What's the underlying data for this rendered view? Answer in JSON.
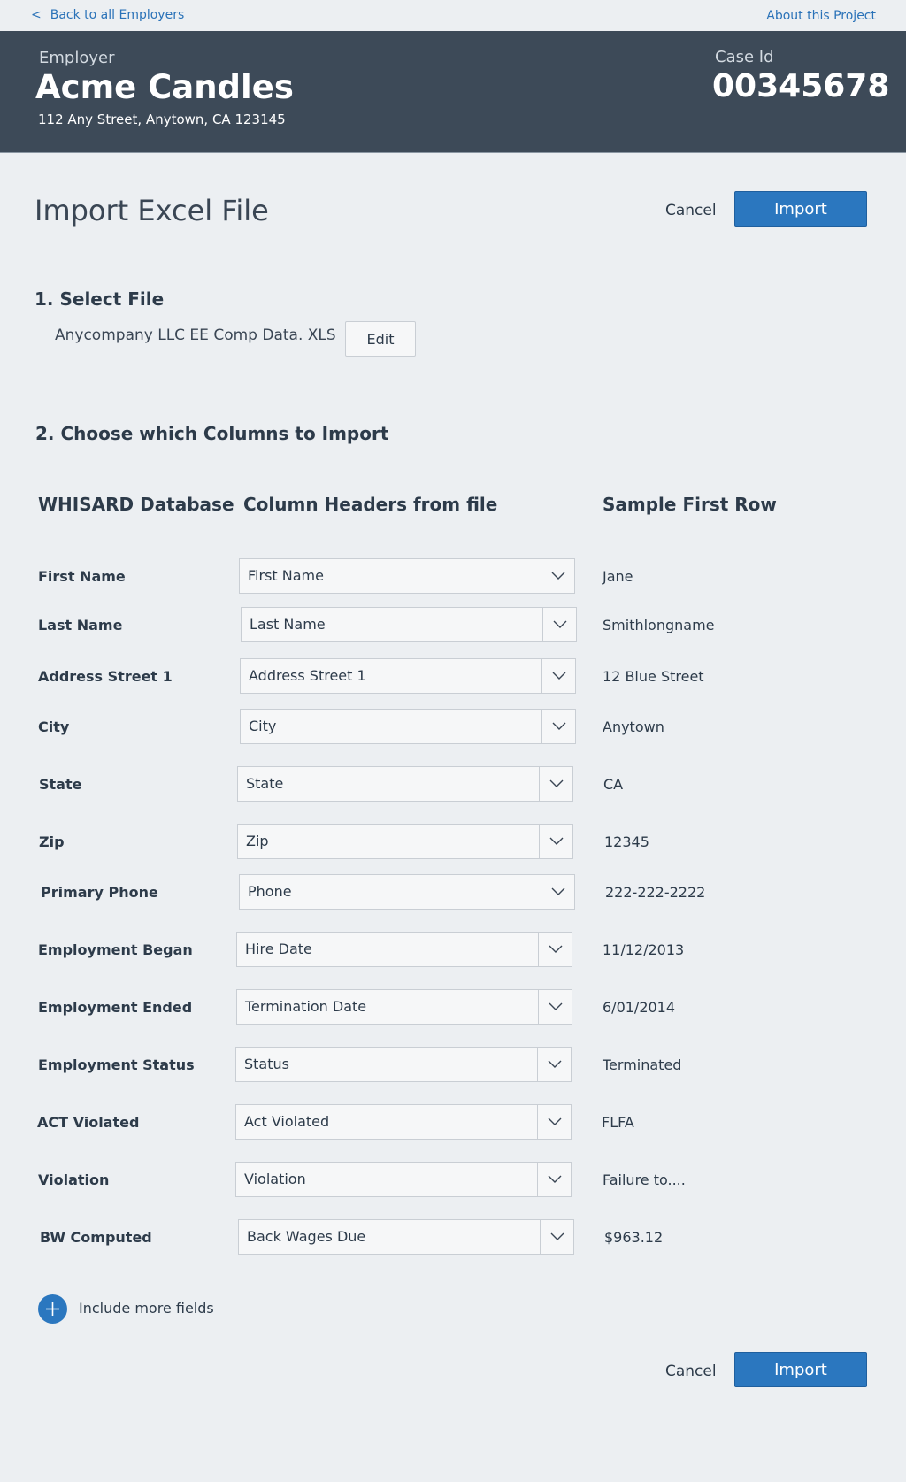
{
  "nav": {
    "back_chevron": "<",
    "back_label": "Back to all Employers",
    "about_label": "About this Project"
  },
  "employer": {
    "label": "Employer",
    "name": "Acme Candles",
    "address": "112 Any Street, Anytown, CA  123145",
    "case_label": "Case Id",
    "case_id": "00345678"
  },
  "page": {
    "title": "Import Excel File",
    "cancel_label": "Cancel",
    "import_label": "Import"
  },
  "select_file": {
    "heading": "1. Select File",
    "file_name": "Anycompany LLC EE Comp Data. XLS",
    "edit_label": "Edit"
  },
  "columns": {
    "heading": "2. Choose which Columns to Import",
    "col_db": "WHISARD Database",
    "col_file": "Column Headers from file",
    "col_sample": "Sample First Row",
    "rows": [
      {
        "field": "First Name",
        "header": "First Name",
        "sample": "Jane"
      },
      {
        "field": "Last Name",
        "header": "Last Name",
        "sample": "Smithlongname"
      },
      {
        "field": "Address Street 1",
        "header": "Address Street 1",
        "sample": "12 Blue Street"
      },
      {
        "field": "City",
        "header": "City",
        "sample": "Anytown"
      },
      {
        "field": "State",
        "header": "State",
        "sample": "CA"
      },
      {
        "field": "Zip",
        "header": "Zip",
        "sample": "12345"
      },
      {
        "field": "Primary Phone",
        "header": "Phone",
        "sample": "222-222-2222"
      },
      {
        "field": "Employment Began",
        "header": "Hire Date",
        "sample": "11/12/2013"
      },
      {
        "field": "Employment Ended",
        "header": "Termination Date",
        "sample": "6/01/2014"
      },
      {
        "field": "Employment Status",
        "header": "Status",
        "sample": "Terminated"
      },
      {
        "field": "ACT Violated",
        "header": "Act Violated",
        "sample": "FLFA"
      },
      {
        "field": "Violation",
        "header": "Violation",
        "sample": "Failure to...."
      },
      {
        "field": "BW Computed",
        "header": "Back Wages Due",
        "sample": "$963.12"
      }
    ]
  },
  "more": {
    "label": "Include more fields",
    "icon": "plus-icon"
  },
  "colors": {
    "banner": "#3d4a58",
    "accent": "#2b77bf",
    "page_bg": "#eceff2"
  }
}
